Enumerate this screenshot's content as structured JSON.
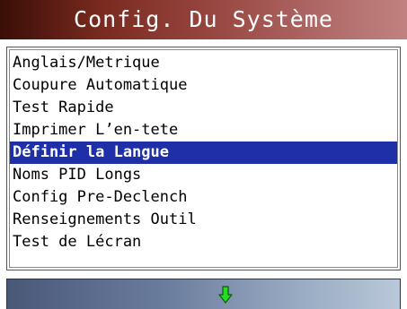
{
  "header": {
    "title": "Config. Du Système"
  },
  "menu": {
    "items": [
      {
        "label": "Anglais/Metrique",
        "selected": false
      },
      {
        "label": "Coupure Automatique",
        "selected": false
      },
      {
        "label": "Test Rapide",
        "selected": false
      },
      {
        "label": "Imprimer L’en-tete",
        "selected": false
      },
      {
        "label": "Définir la Langue",
        "selected": true
      },
      {
        "label": "Noms PID Longs",
        "selected": false
      },
      {
        "label": "Config Pre-Declench",
        "selected": false
      },
      {
        "label": "Renseignements Outil",
        "selected": false
      },
      {
        "label": "Test de Lécran",
        "selected": false
      }
    ]
  },
  "footer": {
    "icon": "down-arrow-icon",
    "icon_color": "#22dd22"
  },
  "colors": {
    "selection": "#1f2fa8",
    "title_gradient_start": "#3a0e06",
    "title_gradient_end": "#c08280"
  }
}
